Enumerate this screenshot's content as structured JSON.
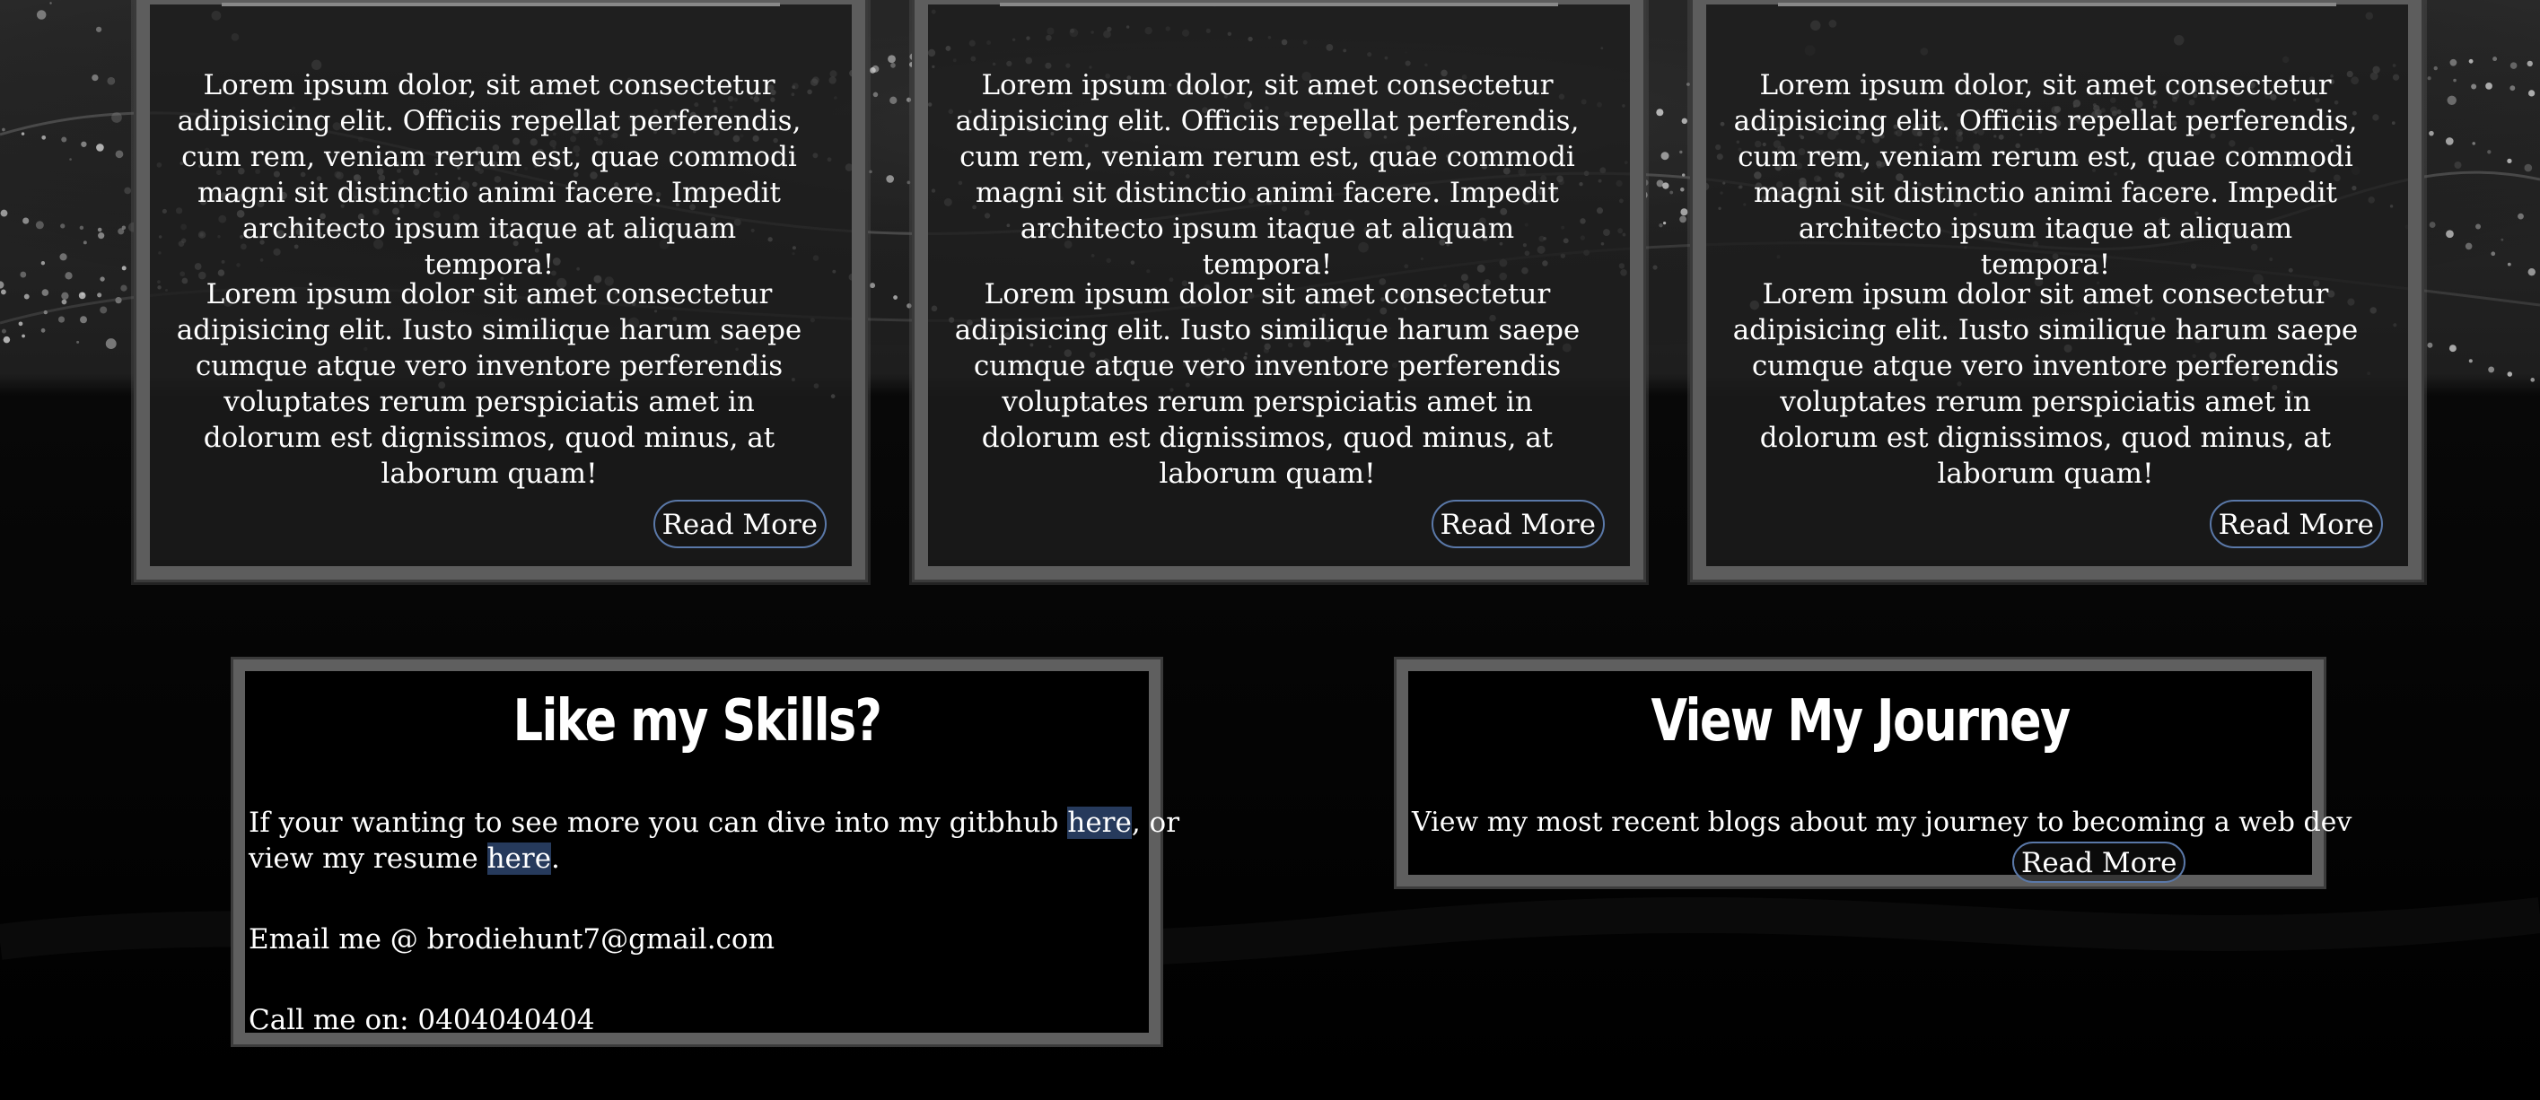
{
  "cards": [
    {
      "para1": "Lorem ipsum dolor, sit amet consectetur adipisicing elit. Officiis repellat perferendis, cum rem, veniam rerum est, quae commodi magni sit distinctio animi facere. Impedit architecto ipsum itaque at aliquam tempora!",
      "para2": "Lorem ipsum dolor sit amet consectetur adipisicing elit. Iusto similique harum saepe cumque atque vero inventore perferendis voluptates rerum perspiciatis amet in dolorum est dignissimos, quod minus, at laborum quam!",
      "read_more": "Read More"
    },
    {
      "para1": "Lorem ipsum dolor, sit amet consectetur adipisicing elit. Officiis repellat perferendis, cum rem, veniam rerum est, quae commodi magni sit distinctio animi facere. Impedit architecto ipsum itaque at aliquam tempora!",
      "para2": "Lorem ipsum dolor sit amet consectetur adipisicing elit. Iusto similique harum saepe cumque atque vero inventore perferendis voluptates rerum perspiciatis amet in dolorum est dignissimos, quod minus, at laborum quam!",
      "read_more": "Read More"
    },
    {
      "para1": "Lorem ipsum dolor, sit amet consectetur adipisicing elit. Officiis repellat perferendis, cum rem, veniam rerum est, quae commodi magni sit distinctio animi facere. Impedit architecto ipsum itaque at aliquam tempora!",
      "para2": "Lorem ipsum dolor sit amet consectetur adipisicing elit. Iusto similique harum saepe cumque atque vero inventore perferendis voluptates rerum perspiciatis amet in dolorum est dignissimos, quod minus, at laborum quam!",
      "read_more": "Read More"
    }
  ],
  "skills": {
    "title": "Like my Skills?",
    "line1_before": "If your wanting to see more you can dive into my gitbhub ",
    "link1": "here",
    "line1_after": ", or",
    "line2_before": "view my resume ",
    "link2": "here",
    "line2_after": ".",
    "email": "Email me @ brodiehunt7@gmail.com",
    "phone": "Call me on: 0404040404"
  },
  "journey": {
    "title": "View My Journey",
    "text": "View my most recent blogs about my journey to becoming a web dev",
    "read_more": "Read More"
  },
  "colors": {
    "background": "#000000",
    "frame": "#5f5f5f",
    "link_highlight": "#263a5c",
    "button_border": "#5a78a8"
  }
}
